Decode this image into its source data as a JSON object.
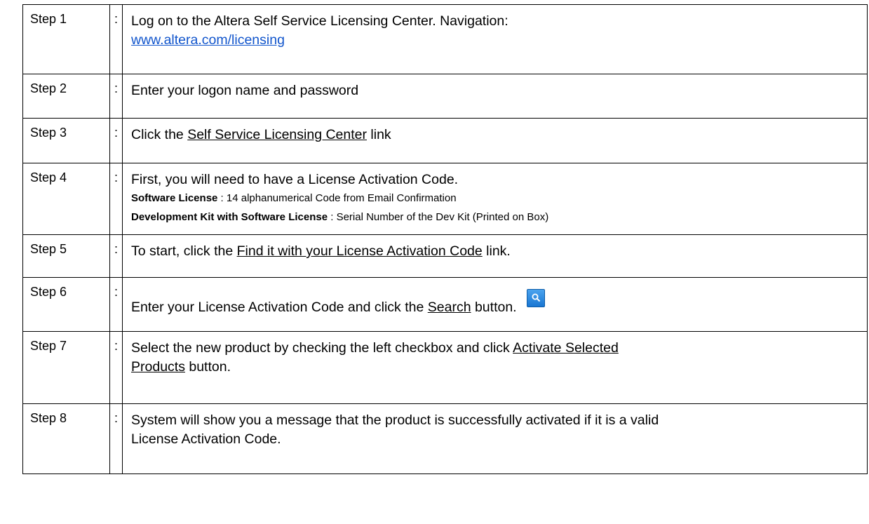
{
  "steps": [
    {
      "label": "Step 1",
      "colon": ":",
      "text": "Log on to the Altera Self Service Licensing Center. Navigation:",
      "link_text": "www.altera.com/licensing"
    },
    {
      "label": "Step 2",
      "colon": ":",
      "text": "Enter your logon name and password"
    },
    {
      "label": "Step 3",
      "colon": ":",
      "pre": "Click the ",
      "link_text": "Self Service Licensing Center",
      "post": " link"
    },
    {
      "label": "Step 4",
      "colon": ":",
      "text": "First, you will need to have a License Activation Code.",
      "sub1_bold": "Software License",
      "sub1_rest": " : 14 alphanumerical Code from Email Confirmation",
      "sub2_bold": "Development Kit with Software License",
      "sub2_rest": " : Serial Number of the Dev Kit (Printed on Box)"
    },
    {
      "label": "Step 5",
      "colon": ":",
      "pre": "To start, click the ",
      "link_text": "Find it with your License Activation Code",
      "post": " link."
    },
    {
      "label": "Step 6",
      "colon": ":",
      "pre": "Enter your License Activation Code and click the ",
      "link_text": "Search",
      "post": " button.",
      "icon": "search-icon"
    },
    {
      "label": "Step 7",
      "colon": ":",
      "pre": "Select the new product by checking the left checkbox and click ",
      "link_text_a": "Activate Selected",
      "link_text_b": "Products",
      "post": " button."
    },
    {
      "label": "Step 8",
      "colon": ":",
      "text_a": "System will show you a message that the product is successfully activated if it is a valid",
      "text_b": "License Activation Code."
    }
  ]
}
